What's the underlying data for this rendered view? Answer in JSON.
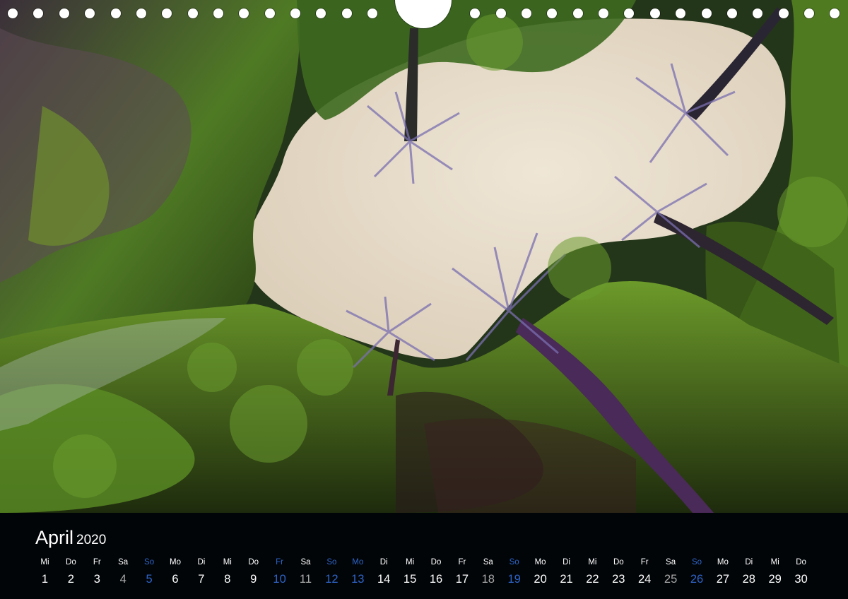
{
  "calendar": {
    "month": "April",
    "year": "2020",
    "days": [
      {
        "dow": "Mi",
        "num": "1",
        "kind": "weekday"
      },
      {
        "dow": "Do",
        "num": "2",
        "kind": "weekday"
      },
      {
        "dow": "Fr",
        "num": "3",
        "kind": "weekday"
      },
      {
        "dow": "Sa",
        "num": "4",
        "kind": "saturday"
      },
      {
        "dow": "So",
        "num": "5",
        "kind": "sunday"
      },
      {
        "dow": "Mo",
        "num": "6",
        "kind": "weekday"
      },
      {
        "dow": "Di",
        "num": "7",
        "kind": "weekday"
      },
      {
        "dow": "Mi",
        "num": "8",
        "kind": "weekday"
      },
      {
        "dow": "Do",
        "num": "9",
        "kind": "weekday"
      },
      {
        "dow": "Fr",
        "num": "10",
        "kind": "holiday"
      },
      {
        "dow": "Sa",
        "num": "11",
        "kind": "saturday"
      },
      {
        "dow": "So",
        "num": "12",
        "kind": "sunday"
      },
      {
        "dow": "Mo",
        "num": "13",
        "kind": "holiday"
      },
      {
        "dow": "Di",
        "num": "14",
        "kind": "weekday"
      },
      {
        "dow": "Mi",
        "num": "15",
        "kind": "weekday"
      },
      {
        "dow": "Do",
        "num": "16",
        "kind": "weekday"
      },
      {
        "dow": "Fr",
        "num": "17",
        "kind": "weekday"
      },
      {
        "dow": "Sa",
        "num": "18",
        "kind": "saturday"
      },
      {
        "dow": "So",
        "num": "19",
        "kind": "sunday"
      },
      {
        "dow": "Mo",
        "num": "20",
        "kind": "weekday"
      },
      {
        "dow": "Di",
        "num": "21",
        "kind": "weekday"
      },
      {
        "dow": "Mi",
        "num": "22",
        "kind": "weekday"
      },
      {
        "dow": "Do",
        "num": "23",
        "kind": "weekday"
      },
      {
        "dow": "Fr",
        "num": "24",
        "kind": "weekday"
      },
      {
        "dow": "Sa",
        "num": "25",
        "kind": "saturday"
      },
      {
        "dow": "So",
        "num": "26",
        "kind": "sunday"
      },
      {
        "dow": "Mo",
        "num": "27",
        "kind": "weekday"
      },
      {
        "dow": "Di",
        "num": "28",
        "kind": "weekday"
      },
      {
        "dow": "Mi",
        "num": "29",
        "kind": "weekday"
      },
      {
        "dow": "Do",
        "num": "30",
        "kind": "weekday"
      }
    ]
  },
  "colors": {
    "background": "#020508",
    "text": "#ffffff",
    "sunday_holiday": "#2e64c8",
    "saturday": "#a9a9a9",
    "sky": "#e8ddcc",
    "foliage": "#3f6a1c"
  }
}
